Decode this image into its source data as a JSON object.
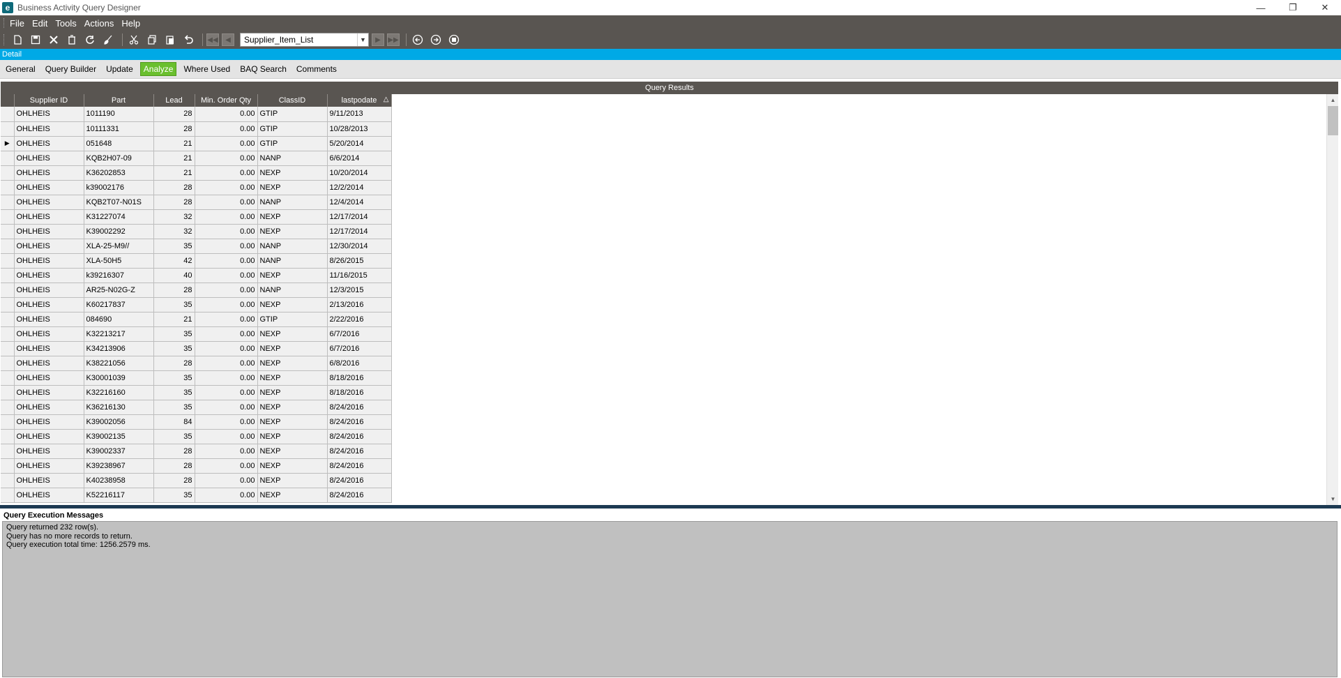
{
  "window": {
    "logo_letter": "e",
    "title": "Business Activity Query Designer",
    "minimize": "—",
    "restore": "❐",
    "close": "✕"
  },
  "menu": [
    "File",
    "Edit",
    "Tools",
    "Actions",
    "Help"
  ],
  "toolbar": {
    "query_name": "Supplier_Item_List"
  },
  "detail_label": "Detail",
  "tabs": [
    "General",
    "Query Builder",
    "Update",
    "Analyze",
    "Where Used",
    "BAQ Search",
    "Comments"
  ],
  "active_tab": "Analyze",
  "results": {
    "title": "Query Results",
    "columns": [
      "Supplier ID",
      "Part",
      "Lead",
      "Min. Order Qty",
      "ClassID",
      "lastpodate"
    ],
    "rows": [
      [
        "OHLHEIS",
        "1011190",
        "28",
        "0.00",
        "GTIP",
        "9/11/2013"
      ],
      [
        "OHLHEIS",
        "10111331",
        "28",
        "0.00",
        "GTIP",
        "10/28/2013"
      ],
      [
        "OHLHEIS",
        "051648",
        "21",
        "0.00",
        "GTIP",
        "5/20/2014"
      ],
      [
        "OHLHEIS",
        "KQB2H07-09",
        "21",
        "0.00",
        "NANP",
        "6/6/2014"
      ],
      [
        "OHLHEIS",
        "K36202853",
        "21",
        "0.00",
        "NEXP",
        "10/20/2014"
      ],
      [
        "OHLHEIS",
        "k39002176",
        "28",
        "0.00",
        "NEXP",
        "12/2/2014"
      ],
      [
        "OHLHEIS",
        "KQB2T07-N01S",
        "28",
        "0.00",
        "NANP",
        "12/4/2014"
      ],
      [
        "OHLHEIS",
        "K31227074",
        "32",
        "0.00",
        "NEXP",
        "12/17/2014"
      ],
      [
        "OHLHEIS",
        "K39002292",
        "32",
        "0.00",
        "NEXP",
        "12/17/2014"
      ],
      [
        "OHLHEIS",
        "XLA-25-M9//",
        "35",
        "0.00",
        "NANP",
        "12/30/2014"
      ],
      [
        "OHLHEIS",
        "XLA-50H5",
        "42",
        "0.00",
        "NANP",
        "8/26/2015"
      ],
      [
        "OHLHEIS",
        "k39216307",
        "40",
        "0.00",
        "NEXP",
        "11/16/2015"
      ],
      [
        "OHLHEIS",
        "AR25-N02G-Z",
        "28",
        "0.00",
        "NANP",
        "12/3/2015"
      ],
      [
        "OHLHEIS",
        "K60217837",
        "35",
        "0.00",
        "NEXP",
        "2/13/2016"
      ],
      [
        "OHLHEIS",
        "084690",
        "21",
        "0.00",
        "GTIP",
        "2/22/2016"
      ],
      [
        "OHLHEIS",
        "K32213217",
        "35",
        "0.00",
        "NEXP",
        "6/7/2016"
      ],
      [
        "OHLHEIS",
        "K34213906",
        "35",
        "0.00",
        "NEXP",
        "6/7/2016"
      ],
      [
        "OHLHEIS",
        "K38221056",
        "28",
        "0.00",
        "NEXP",
        "6/8/2016"
      ],
      [
        "OHLHEIS",
        "K30001039",
        "35",
        "0.00",
        "NEXP",
        "8/18/2016"
      ],
      [
        "OHLHEIS",
        "K32216160",
        "35",
        "0.00",
        "NEXP",
        "8/18/2016"
      ],
      [
        "OHLHEIS",
        "K36216130",
        "35",
        "0.00",
        "NEXP",
        "8/24/2016"
      ],
      [
        "OHLHEIS",
        "K39002056",
        "84",
        "0.00",
        "NEXP",
        "8/24/2016"
      ],
      [
        "OHLHEIS",
        "K39002135",
        "35",
        "0.00",
        "NEXP",
        "8/24/2016"
      ],
      [
        "OHLHEIS",
        "K39002337",
        "28",
        "0.00",
        "NEXP",
        "8/24/2016"
      ],
      [
        "OHLHEIS",
        "K39238967",
        "28",
        "0.00",
        "NEXP",
        "8/24/2016"
      ],
      [
        "OHLHEIS",
        "K40238958",
        "28",
        "0.00",
        "NEXP",
        "8/24/2016"
      ],
      [
        "OHLHEIS",
        "K52216117",
        "35",
        "0.00",
        "NEXP",
        "8/24/2016"
      ]
    ],
    "current_row_index": 2
  },
  "messages": {
    "title": "Query Execution Messages",
    "lines": [
      "Query returned 232 row(s).",
      "Query has no more records to return.",
      "Query execution total time: 1256.2579 ms."
    ]
  },
  "colors": {
    "chrome": "#595551",
    "detail_strip": "#00a9e6",
    "active_tab": "#6abf2e",
    "message_bg": "#c0c0c0"
  }
}
